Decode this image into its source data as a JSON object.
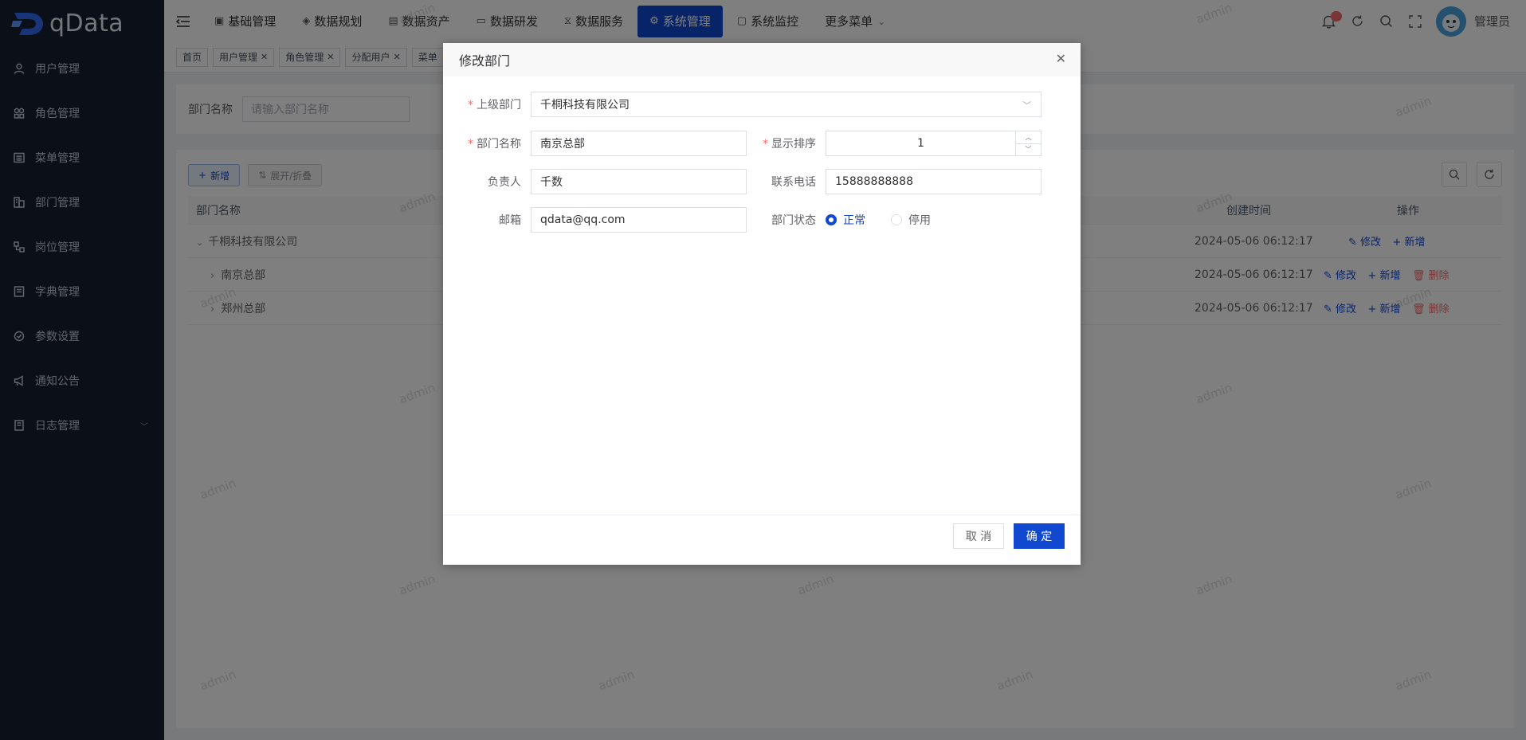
{
  "app": {
    "logo_text": "qData"
  },
  "sidebar": {
    "items": [
      {
        "label": "用户管理",
        "icon": "user-icon"
      },
      {
        "label": "角色管理",
        "icon": "users-icon"
      },
      {
        "label": "菜单管理",
        "icon": "menu-icon"
      },
      {
        "label": "部门管理",
        "icon": "department-icon"
      },
      {
        "label": "岗位管理",
        "icon": "position-icon"
      },
      {
        "label": "字典管理",
        "icon": "dictionary-icon"
      },
      {
        "label": "参数设置",
        "icon": "settings-icon"
      },
      {
        "label": "通知公告",
        "icon": "megaphone-icon"
      },
      {
        "label": "日志管理",
        "icon": "log-icon"
      }
    ]
  },
  "topnav": {
    "items": [
      {
        "label": "基础管理",
        "icon": "▣"
      },
      {
        "label": "数据规划",
        "icon": "◈"
      },
      {
        "label": "数据资产",
        "icon": "▤"
      },
      {
        "label": "数据研发",
        "icon": "▭"
      },
      {
        "label": "数据服务",
        "icon": "⧖"
      },
      {
        "label": "系统管理",
        "icon": "⚙"
      },
      {
        "label": "系统监控",
        "icon": "▢"
      },
      {
        "label": "更多菜单",
        "icon": ""
      }
    ],
    "active_index": 5,
    "more_chevron": "⌄"
  },
  "topright": {
    "username": "管理员"
  },
  "tags": [
    {
      "label": "首页",
      "closable": false
    },
    {
      "label": "用户管理",
      "closable": true
    },
    {
      "label": "角色管理",
      "closable": true
    },
    {
      "label": "分配用户",
      "closable": true
    },
    {
      "label": "菜单",
      "closable": false
    }
  ],
  "search": {
    "label": "部门名称",
    "placeholder": "请输入部门名称"
  },
  "toolbar": {
    "add_label": "新增",
    "expand_label": "展开/折叠"
  },
  "table": {
    "headers": {
      "name": "部门名称",
      "time": "创建时间",
      "op": "操作"
    },
    "rows": [
      {
        "name": "千桐科技有限公司",
        "time": "2024-05-06 06:12:17",
        "expand": "⌄",
        "edit": "修改",
        "add": "新增",
        "delete": ""
      },
      {
        "name": "南京总部",
        "time": "2024-05-06 06:12:17",
        "expand": "›",
        "edit": "修改",
        "add": "新增",
        "delete": "删除"
      },
      {
        "name": "郑州总部",
        "time": "2024-05-06 06:12:17",
        "expand": "›",
        "edit": "修改",
        "add": "新增",
        "delete": "删除"
      }
    ]
  },
  "dialog": {
    "title": "修改部门",
    "parent": {
      "label": "上级部门",
      "value": "千桐科技有限公司"
    },
    "name": {
      "label": "部门名称",
      "value": "南京总部"
    },
    "order": {
      "label": "显示排序",
      "value": "1"
    },
    "leader": {
      "label": "负责人",
      "value": "千数"
    },
    "phone": {
      "label": "联系电话",
      "value": "15888888888"
    },
    "email": {
      "label": "邮箱",
      "value": "qdata@qq.com"
    },
    "status": {
      "label": "部门状态",
      "options": [
        "正常",
        "停用"
      ],
      "selected": 0
    },
    "cancel_label": "取 消",
    "ok_label": "确 定"
  },
  "watermark": "admin",
  "colors": {
    "primary": "#1148d0",
    "sidebar": "#171f2e",
    "danger": "#f56c6c"
  }
}
